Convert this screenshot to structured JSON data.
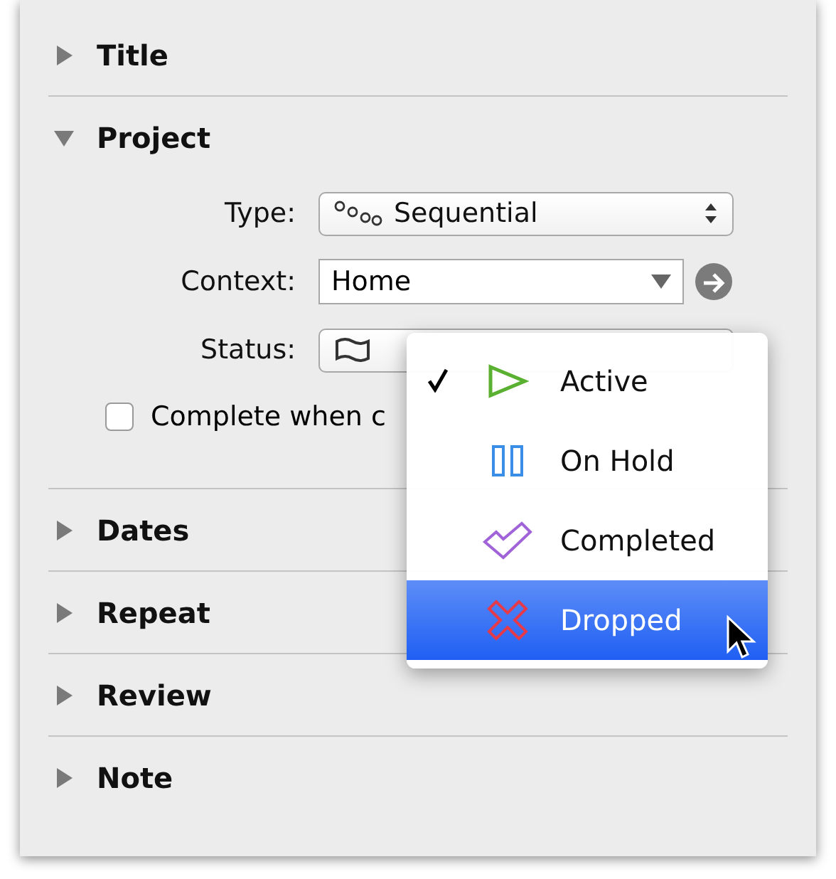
{
  "sections": [
    {
      "title": "Title",
      "expanded": false
    },
    {
      "title": "Project",
      "expanded": true
    },
    {
      "title": "Dates",
      "expanded": false
    },
    {
      "title": "Repeat",
      "expanded": false
    },
    {
      "title": "Review",
      "expanded": false
    },
    {
      "title": "Note",
      "expanded": false
    }
  ],
  "project": {
    "type": {
      "label": "Type:",
      "value": "Sequential"
    },
    "context": {
      "label": "Context:",
      "value": "Home"
    },
    "status": {
      "label": "Status:"
    },
    "complete_checkbox": {
      "label": "Complete when c",
      "checked": false
    }
  },
  "status_menu": {
    "items": [
      {
        "label": "Active",
        "kind": "active",
        "checked": true,
        "selected": false
      },
      {
        "label": "On Hold",
        "kind": "hold",
        "checked": false,
        "selected": false
      },
      {
        "label": "Completed",
        "kind": "completed",
        "checked": false,
        "selected": false
      },
      {
        "label": "Dropped",
        "kind": "dropped",
        "checked": false,
        "selected": true
      }
    ]
  }
}
